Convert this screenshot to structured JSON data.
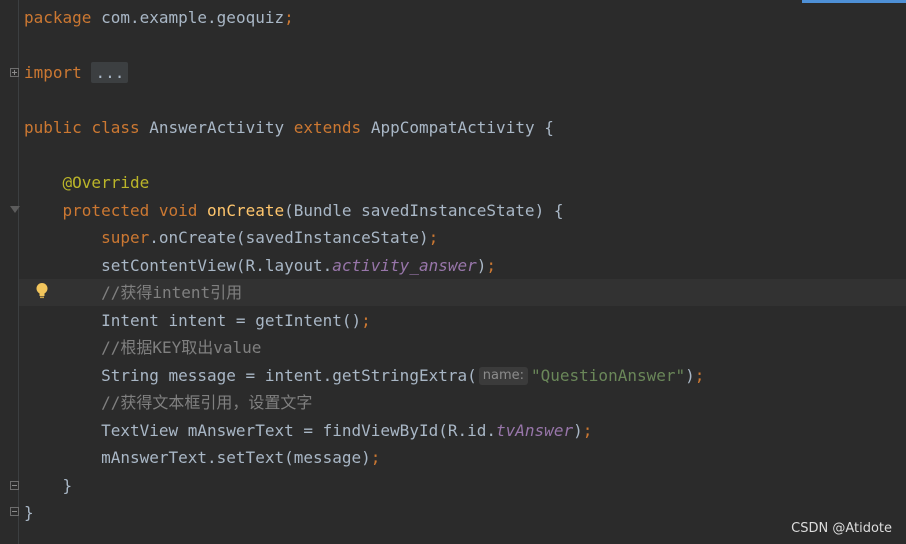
{
  "code": {
    "line_package": "com.example.geoquiz",
    "kw_package": "package",
    "kw_import": "import",
    "import_fold": "...",
    "kw_public": "public",
    "kw_class": "class",
    "class_name": "AnswerActivity",
    "kw_extends": "extends",
    "parent_class": "AppCompatActivity",
    "annotation": "@Override",
    "kw_protected": "protected",
    "kw_void": "void",
    "method_name": "onCreate",
    "method_params": "(Bundle savedInstanceState) {",
    "kw_super": "super",
    "super_call": ".onCreate(savedInstanceState)",
    "set_content": "setContentView(R.layout.",
    "layout_field": "activity_answer",
    "comment_1": "//获得intent引用",
    "intent_line": "Intent intent = getIntent()",
    "comment_2": "//根据KEY取出value",
    "string_line": "String message = intent.getStringExtra(",
    "param_hint": "name:",
    "string_literal": "\"QuestionAnswer\"",
    "comment_3": "//获得文本框引用，设置文字",
    "textview_line": "TextView mAnswerText = findViewById(R.id.",
    "id_field": "tvAnswer",
    "settext_line": "mAnswerText.setText(message)",
    "close_method": "}",
    "close_class": "}"
  },
  "watermark": "CSDN @Atidote",
  "icons": {
    "intention": "lightbulb-icon",
    "fold_expand": "fold-plus-icon",
    "fold_collapse": "fold-minus-icon"
  },
  "colors": {
    "background": "#2b2b2b",
    "keyword": "#cc7832",
    "annotation": "#bbb529",
    "function": "#ffc66d",
    "field": "#9876aa",
    "string": "#6a8759",
    "comment": "#808080",
    "text": "#a9b7c6"
  }
}
